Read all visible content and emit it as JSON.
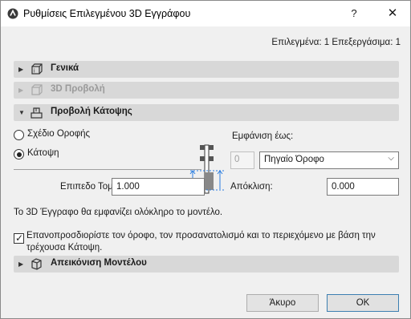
{
  "window": {
    "title": "Ρυθμίσεις Επιλεγμένου 3D Εγγράφου",
    "help_label": "?",
    "close_label": "✕"
  },
  "selection_info": "Επιλεγμένα: 1 Επεξεργάσιμα: 1",
  "sections": {
    "general": {
      "label": "Γενικά",
      "expanded": false
    },
    "view3d": {
      "label": "3D Προβολή",
      "expanded": false,
      "disabled": true
    },
    "floor_plan": {
      "label": "Προβολή Κάτοψης",
      "expanded": true
    },
    "model_display": {
      "label": "Απεικόνιση Μοντέλου",
      "expanded": false
    }
  },
  "floor_plan": {
    "radio_ceiling": {
      "label": "Σχέδιο Οροφής",
      "checked": false
    },
    "radio_plan": {
      "label": "Κάτοψη",
      "checked": true
    },
    "show_to_label": "Εμφάνιση έως:",
    "show_to_number": "0",
    "show_to_select": "Πηγαίο Όροφο",
    "cut_plane_label": "Επιπεδο Τομής:",
    "cut_plane_value": "1.000",
    "offset_label": "Απόκλιση:",
    "offset_value": "0.000"
  },
  "info_text": "Το 3D Έγγραφο θα εμφανίζει ολόκληρο το μοντέλο.",
  "reposition_checkbox": {
    "checked": true,
    "label": "Επανοπροσδιορίστε τον όροφο, τον προσανατολισμό και το περιεχόμενο με βάση την τρέχουσα Κάτοψη."
  },
  "buttons": {
    "cancel": "Άκυρο",
    "ok": "OK"
  }
}
